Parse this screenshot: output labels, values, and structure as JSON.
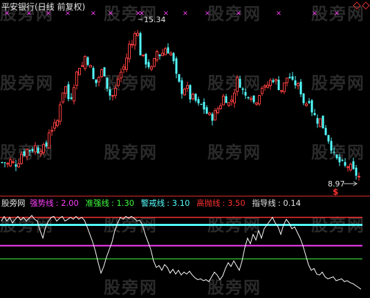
{
  "title": "平安银行(日线 前复权)",
  "watermark": "股旁网",
  "colors": {
    "up": "#ff4040",
    "down": "#54ffff",
    "cross": "#ff40ff",
    "strong_line": "#ff40ff",
    "quasi_line": "#40ff40",
    "warn_line": "#54ffff",
    "high_line": "#ff3030",
    "guide_line": "#ffffff",
    "separator": "#a02020"
  },
  "markers": {
    "high_label": "15.34",
    "low_label": "8.97",
    "s_label": "$"
  },
  "indicator": {
    "name": "股旁网",
    "levels": [
      {
        "key": "strong",
        "label": "强势线",
        "value": "2.00"
      },
      {
        "key": "quasi",
        "label": "准强线",
        "value": "1.30"
      },
      {
        "key": "warn",
        "label": "警戒线",
        "value": "3.10"
      },
      {
        "key": "high",
        "label": "高抛线",
        "value": "3.50"
      },
      {
        "key": "guide",
        "label": "指导线",
        "value": "0.14"
      }
    ]
  },
  "chart_data": [
    {
      "type": "candlestick",
      "title": "平安银行(日线 前复权)",
      "ylim": [
        8.6,
        15.7
      ],
      "high_annotation": 15.34,
      "low_annotation": 8.97,
      "close_path": [
        [
          0,
          9.6
        ],
        [
          6,
          9.65
        ],
        [
          10,
          9.5
        ],
        [
          14,
          9.7
        ],
        [
          18,
          9.6
        ],
        [
          22,
          9.55
        ],
        [
          26,
          9.6
        ],
        [
          28,
          9.8
        ],
        [
          32,
          10.05
        ],
        [
          36,
          10.0
        ],
        [
          40,
          10.2
        ],
        [
          44,
          10.1
        ],
        [
          48,
          10.2
        ],
        [
          52,
          10.3
        ],
        [
          54,
          10.1
        ],
        [
          58,
          10.2
        ],
        [
          62,
          10.3
        ],
        [
          64,
          10.1
        ],
        [
          66,
          10.0
        ],
        [
          68,
          10.6
        ],
        [
          70,
          10.9
        ],
        [
          74,
          11.0
        ],
        [
          78,
          11.1
        ],
        [
          82,
          11.15
        ],
        [
          84,
          11.5
        ],
        [
          88,
          12.3
        ],
        [
          90,
          12.5
        ],
        [
          94,
          12.8
        ],
        [
          98,
          12.5
        ],
        [
          100,
          12.0
        ],
        [
          104,
          12.5
        ],
        [
          108,
          13.0
        ],
        [
          112,
          13.4
        ],
        [
          116,
          13.7
        ],
        [
          118,
          13.5
        ],
        [
          122,
          13.9
        ],
        [
          124,
          14.1
        ],
        [
          126,
          13.6
        ],
        [
          128,
          14.0
        ],
        [
          130,
          13.7
        ],
        [
          134,
          13.0
        ],
        [
          138,
          13.1
        ],
        [
          140,
          12.7
        ],
        [
          144,
          13.3
        ],
        [
          148,
          13.4
        ],
        [
          152,
          13.3
        ],
        [
          156,
          12.6
        ],
        [
          158,
          12.5
        ],
        [
          160,
          12.3
        ],
        [
          164,
          12.4
        ],
        [
          168,
          12.7
        ],
        [
          172,
          13.2
        ],
        [
          176,
          13.4
        ],
        [
          178,
          13.6
        ],
        [
          180,
          13.5
        ],
        [
          184,
          14.1
        ],
        [
          186,
          14.3
        ],
        [
          188,
          14.6
        ],
        [
          190,
          14.3
        ],
        [
          192,
          14.7
        ],
        [
          194,
          14.9
        ],
        [
          196,
          15.3
        ],
        [
          198,
          15.1
        ],
        [
          200,
          14.7
        ],
        [
          202,
          14.3
        ],
        [
          204,
          14.0
        ],
        [
          206,
          13.8
        ],
        [
          208,
          14.0
        ],
        [
          212,
          13.7
        ],
        [
          216,
          13.6
        ],
        [
          220,
          13.4
        ],
        [
          224,
          13.9
        ],
        [
          228,
          14.3
        ],
        [
          232,
          14.0
        ],
        [
          236,
          14.2
        ],
        [
          240,
          14.4
        ],
        [
          244,
          14.2
        ],
        [
          248,
          14.1
        ],
        [
          252,
          13.6
        ],
        [
          256,
          13.0
        ],
        [
          260,
          12.8
        ],
        [
          264,
          12.5
        ],
        [
          268,
          12.8
        ],
        [
          272,
          12.6
        ],
        [
          276,
          12.2
        ],
        [
          280,
          12.3
        ],
        [
          284,
          12.1
        ],
        [
          288,
          11.9
        ],
        [
          292,
          12.0
        ],
        [
          296,
          11.8
        ],
        [
          300,
          11.6
        ],
        [
          304,
          11.5
        ],
        [
          308,
          11.5
        ],
        [
          312,
          11.7
        ],
        [
          316,
          11.9
        ],
        [
          320,
          12.1
        ],
        [
          324,
          12.4
        ],
        [
          328,
          12.2
        ],
        [
          332,
          12.0
        ],
        [
          336,
          12.3
        ],
        [
          340,
          12.7
        ],
        [
          344,
          13.1
        ],
        [
          348,
          12.8
        ],
        [
          352,
          12.5
        ],
        [
          356,
          12.3
        ],
        [
          360,
          12.5
        ],
        [
          364,
          12.4
        ],
        [
          368,
          12.0
        ],
        [
          372,
          12.3
        ],
        [
          376,
          12.6
        ],
        [
          380,
          12.8
        ],
        [
          384,
          12.6
        ],
        [
          388,
          12.9
        ],
        [
          392,
          13.0
        ],
        [
          396,
          13.1
        ],
        [
          400,
          12.9
        ],
        [
          404,
          12.7
        ],
        [
          408,
          12.6
        ],
        [
          412,
          12.9
        ],
        [
          416,
          13.2
        ],
        [
          420,
          13.1
        ],
        [
          424,
          12.8
        ],
        [
          428,
          12.9
        ],
        [
          432,
          12.7
        ],
        [
          436,
          12.5
        ],
        [
          440,
          12.0
        ],
        [
          444,
          12.1
        ],
        [
          448,
          12.3
        ],
        [
          452,
          11.6
        ],
        [
          456,
          11.5
        ],
        [
          460,
          11.3
        ],
        [
          464,
          11.4
        ],
        [
          468,
          11.0
        ],
        [
          472,
          10.8
        ],
        [
          476,
          10.5
        ],
        [
          480,
          10.2
        ],
        [
          484,
          9.8
        ],
        [
          488,
          9.7
        ],
        [
          492,
          9.6
        ],
        [
          496,
          9.5
        ],
        [
          500,
          9.4
        ],
        [
          504,
          9.5
        ],
        [
          508,
          9.35
        ],
        [
          512,
          9.2
        ],
        [
          516,
          9.1
        ],
        [
          520,
          9.0
        ]
      ]
    },
    {
      "type": "line",
      "series": [
        {
          "name": "指导线",
          "points": [
            [
              2,
              3.3
            ],
            [
              6,
              3.55
            ],
            [
              10,
              3.3
            ],
            [
              14,
              3.5
            ],
            [
              18,
              3.2
            ],
            [
              22,
              3.4
            ],
            [
              26,
              3.55
            ],
            [
              30,
              3.35
            ],
            [
              34,
              3.5
            ],
            [
              38,
              3.3
            ],
            [
              42,
              3.45
            ],
            [
              46,
              3.6
            ],
            [
              50,
              3.4
            ],
            [
              54,
              3.3
            ],
            [
              58,
              2.8
            ],
            [
              62,
              2.4
            ],
            [
              66,
              3.0
            ],
            [
              70,
              3.3
            ],
            [
              74,
              3.5
            ],
            [
              78,
              3.55
            ],
            [
              82,
              3.3
            ],
            [
              86,
              3.45
            ],
            [
              90,
              3.55
            ],
            [
              94,
              3.3
            ],
            [
              98,
              3.4
            ],
            [
              102,
              3.5
            ],
            [
              106,
              3.4
            ],
            [
              110,
              3.55
            ],
            [
              114,
              3.4
            ],
            [
              118,
              3.5
            ],
            [
              122,
              3.35
            ],
            [
              126,
              3.0
            ],
            [
              130,
              2.6
            ],
            [
              134,
              2.2
            ],
            [
              138,
              1.7
            ],
            [
              142,
              1.1
            ],
            [
              146,
              0.55
            ],
            [
              150,
              0.9
            ],
            [
              154,
              1.4
            ],
            [
              158,
              1.8
            ],
            [
              162,
              2.2
            ],
            [
              166,
              2.8
            ],
            [
              170,
              3.2
            ],
            [
              174,
              3.5
            ],
            [
              178,
              3.4
            ],
            [
              182,
              3.55
            ],
            [
              186,
              3.45
            ],
            [
              190,
              3.55
            ],
            [
              194,
              3.45
            ],
            [
              198,
              3.3
            ],
            [
              202,
              3.35
            ],
            [
              206,
              3.1
            ],
            [
              210,
              2.6
            ],
            [
              214,
              2.2
            ],
            [
              218,
              1.8
            ],
            [
              222,
              1.2
            ],
            [
              226,
              0.85
            ],
            [
              230,
              0.95
            ],
            [
              234,
              0.7
            ],
            [
              238,
              1.0
            ],
            [
              242,
              0.85
            ],
            [
              246,
              0.55
            ],
            [
              250,
              0.75
            ],
            [
              254,
              0.5
            ],
            [
              258,
              0.7
            ],
            [
              262,
              0.45
            ],
            [
              266,
              0.6
            ],
            [
              270,
              0.5
            ],
            [
              274,
              0.65
            ],
            [
              278,
              0.45
            ],
            [
              282,
              0.3
            ],
            [
              286,
              0.2
            ],
            [
              290,
              0.25
            ],
            [
              294,
              0.15
            ],
            [
              298,
              0.2
            ],
            [
              302,
              0.1
            ],
            [
              306,
              0.35
            ],
            [
              310,
              0.6
            ],
            [
              314,
              0.45
            ],
            [
              318,
              0.2
            ],
            [
              322,
              0.4
            ],
            [
              326,
              0.8
            ],
            [
              330,
              1.1
            ],
            [
              334,
              0.9
            ],
            [
              338,
              1.2
            ],
            [
              342,
              0.95
            ],
            [
              346,
              0.7
            ],
            [
              350,
              1.2
            ],
            [
              354,
              1.9
            ],
            [
              358,
              2.4
            ],
            [
              362,
              2.1
            ],
            [
              366,
              2.6
            ],
            [
              370,
              2.3
            ],
            [
              374,
              2.8
            ],
            [
              378,
              2.4
            ],
            [
              382,
              2.9
            ],
            [
              386,
              3.1
            ],
            [
              390,
              3.3
            ],
            [
              394,
              3.5
            ],
            [
              398,
              3.2
            ],
            [
              402,
              3.0
            ],
            [
              406,
              2.6
            ],
            [
              410,
              3.1
            ],
            [
              414,
              3.4
            ],
            [
              418,
              3.2
            ],
            [
              422,
              2.9
            ],
            [
              426,
              3.0
            ],
            [
              430,
              2.7
            ],
            [
              434,
              2.4
            ],
            [
              438,
              2.0
            ],
            [
              442,
              1.5
            ],
            [
              446,
              1.0
            ],
            [
              450,
              0.7
            ],
            [
              454,
              0.8
            ],
            [
              458,
              0.5
            ],
            [
              462,
              0.45
            ],
            [
              466,
              0.6
            ],
            [
              470,
              0.35
            ],
            [
              474,
              0.25
            ],
            [
              478,
              0.3
            ],
            [
              482,
              0.35
            ],
            [
              486,
              0.15
            ],
            [
              490,
              0.2
            ],
            [
              494,
              0.25
            ],
            [
              498,
              0.1
            ],
            [
              502,
              0.15
            ],
            [
              506,
              0.05
            ],
            [
              510,
              0.0
            ],
            [
              514,
              -0.1
            ],
            [
              518,
              -0.2
            ],
            [
              522,
              -0.3
            ]
          ]
        }
      ],
      "horizontal_lines": [
        {
          "name": "高抛线",
          "value": 3.5
        },
        {
          "name": "警戒线",
          "value": 3.1
        },
        {
          "name": "强势线",
          "value": 2.0
        },
        {
          "name": "准强线",
          "value": 1.3
        }
      ],
      "ylim": [
        -0.4,
        4.0
      ]
    }
  ]
}
